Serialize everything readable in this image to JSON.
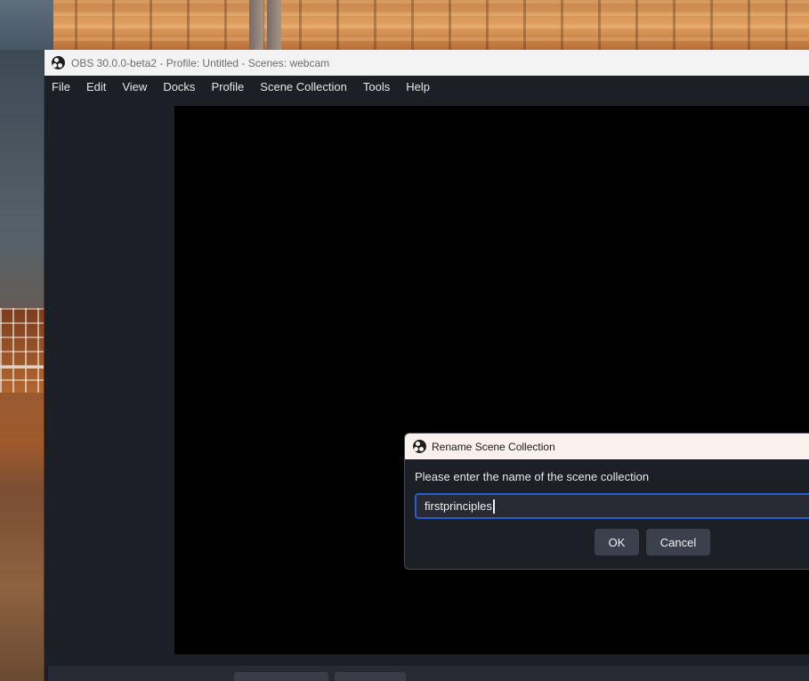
{
  "window": {
    "title": "OBS 30.0.0-beta2 - Profile: Untitled - Scenes: webcam"
  },
  "menubar": {
    "items": [
      "File",
      "Edit",
      "View",
      "Docks",
      "Profile",
      "Scene Collection",
      "Tools",
      "Help"
    ]
  },
  "dialog": {
    "title": "Rename Scene Collection",
    "prompt": "Please enter the name of the scene collection",
    "input_value": "firstprinciples",
    "ok_label": "OK",
    "cancel_label": "Cancel"
  },
  "colors": {
    "window_bg": "#1d1f26",
    "preview_bg": "#000000",
    "input_focus_border": "#2c5bd3",
    "button_bg": "#3c404d"
  }
}
